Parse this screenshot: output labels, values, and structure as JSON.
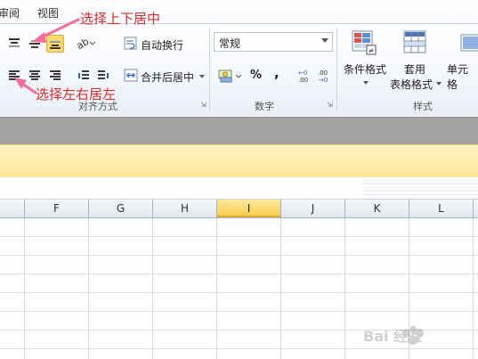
{
  "menu_tabs": [
    "审阅",
    "视图"
  ],
  "ribbon": {
    "alignment_group_label": "对齐方式",
    "wrap_text_label": "自动换行",
    "merge_center_label": "合并后居中",
    "number_group_label": "数字",
    "number_format_value": "常规",
    "percent_symbol": "%",
    "comma_symbol": ",",
    "styles_group_label": "样式",
    "conditional_format_label": "条件格式",
    "table_format_label_1": "套用",
    "table_format_label_2": "表格格式",
    "cell_styles_label": "单元格"
  },
  "annotations": {
    "vertical_align_note": "选择上下居中",
    "horizontal_align_note": "选择左右居左"
  },
  "columns": [
    "F",
    "G",
    "H",
    "I",
    "J",
    "K",
    "L"
  ],
  "active_column": "I",
  "watermark_text": "Bai 经验",
  "colors": {
    "annotation_red": "#d62e2e",
    "arrow_pink": "#f36d9a",
    "selected_button": "#fcd96d",
    "message_bar": "#ffe89a",
    "active_header": "#f7cd52"
  }
}
